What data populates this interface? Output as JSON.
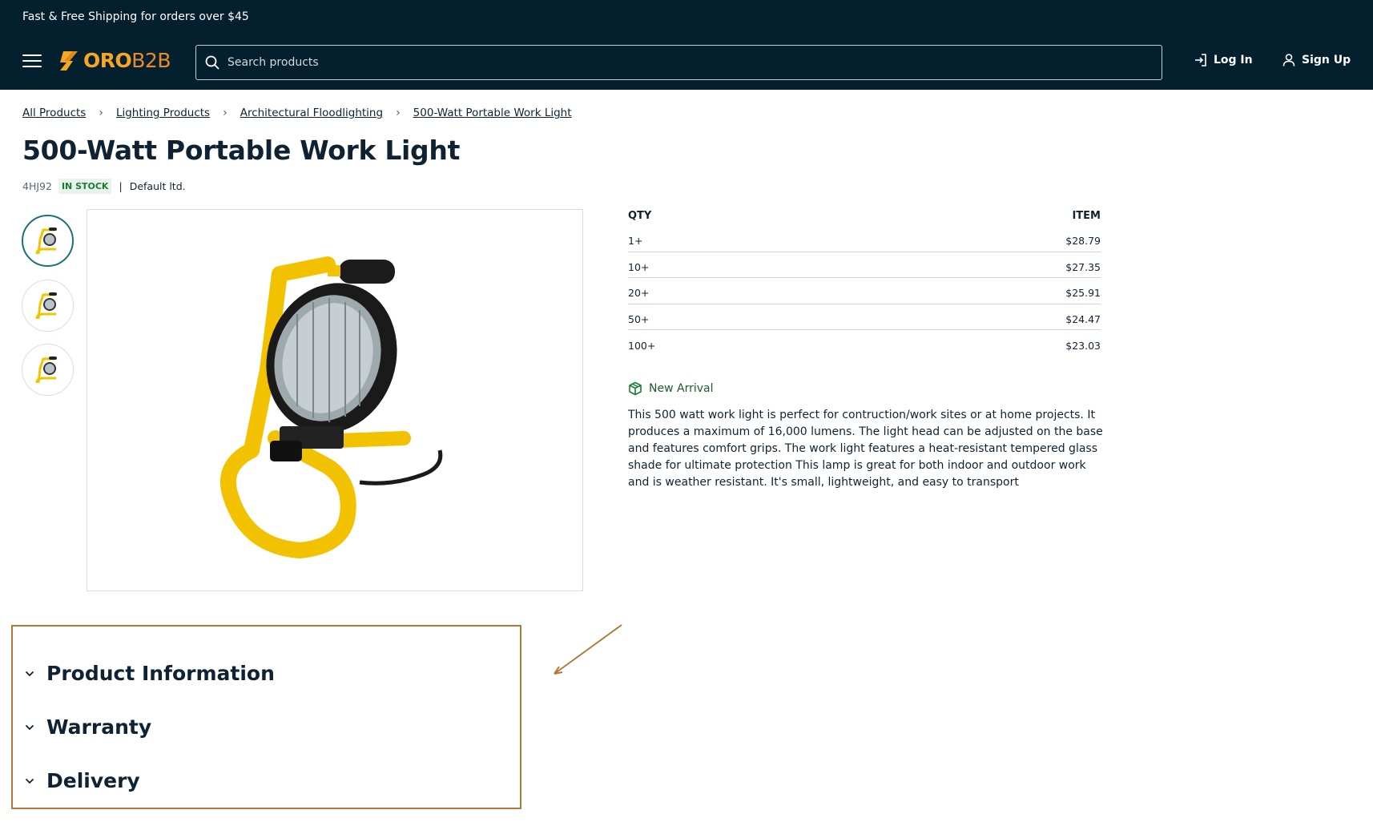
{
  "promo": {
    "text": "Fast & Free Shipping for orders over $45"
  },
  "header": {
    "logo_text_1": "ORO",
    "logo_text_2": "B2B",
    "search_placeholder": "Search products",
    "login_label": "Log In",
    "signup_label": "Sign Up"
  },
  "breadcrumb": [
    "All Products",
    "Lighting Products",
    "Architectural Floodlighting",
    "500-Watt Portable Work Light"
  ],
  "product": {
    "title": "500-Watt Portable Work Light",
    "sku": "4HJ92",
    "stock": "IN STOCK",
    "vendor": "Default ltd.",
    "badge": "New Arrival",
    "description": "This 500 watt work light is perfect for contruction/work sites or at home projects. It produces a maximum of 16,000 lumens. The light head can be adjusted on the base and features comfort grips. The work light features a heat-resistant tempered glass shade for ultimate protection This lamp is great for both indoor and outdoor work and is weather resistant. It's small, lightweight, and easy to transport"
  },
  "pricing": {
    "headers": [
      "QTY",
      "ITEM"
    ],
    "rows": [
      {
        "qty": "1+",
        "price": "$28.79"
      },
      {
        "qty": "10+",
        "price": "$27.35"
      },
      {
        "qty": "20+",
        "price": "$25.91"
      },
      {
        "qty": "50+",
        "price": "$24.47"
      },
      {
        "qty": "100+",
        "price": "$23.03"
      }
    ]
  },
  "accordion": [
    "Product Information",
    "Warranty",
    "Delivery"
  ],
  "colors": {
    "header_bg": "#04202f",
    "logo_orange": "#f5a623",
    "in_stock_bg": "#e6f4ea",
    "in_stock_text": "#1e7a35",
    "annotation_border": "#b07a36"
  }
}
